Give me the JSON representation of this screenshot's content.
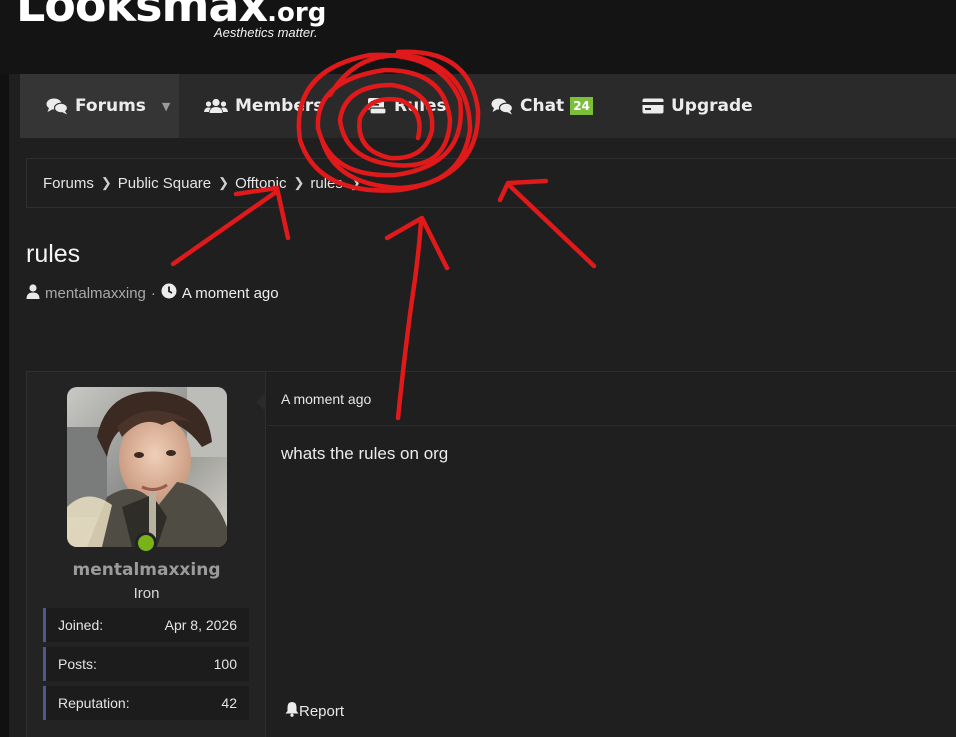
{
  "header": {
    "logo_text": "Looksmax",
    "logo_tld": ".org",
    "tagline": "Aesthetics matter."
  },
  "nav": {
    "items": [
      {
        "label": "Forums",
        "icon": "comments-icon",
        "selected": true
      },
      {
        "label": "Members",
        "icon": "users-icon"
      },
      {
        "label": "Rules",
        "icon": "book-icon"
      },
      {
        "label": "Chat",
        "icon": "chat-icon",
        "badge": "24"
      },
      {
        "label": "Upgrade",
        "icon": "credit-card-icon"
      }
    ]
  },
  "breadcrumb": {
    "items": [
      "Forums",
      "Public Square",
      "Offtopic",
      "rules"
    ]
  },
  "thread": {
    "title": "rules",
    "author": "mentalmaxxing",
    "separator": "·",
    "time": "A moment ago"
  },
  "post": {
    "date": "A moment ago",
    "body": "whats the rules on org",
    "report_label": "Report",
    "user": {
      "name": "mentalmaxxing",
      "rank": "Iron",
      "stats": [
        {
          "label": "Joined:",
          "value": "Apr 8, 2026"
        },
        {
          "label": "Posts:",
          "value": "100"
        },
        {
          "label": "Reputation:",
          "value": "42"
        }
      ]
    }
  },
  "colors": {
    "accent_green": "#7cbf3a",
    "online": "#7ab317",
    "stat_border": "#4a5a8c",
    "annotation_red": "#e0191b"
  }
}
